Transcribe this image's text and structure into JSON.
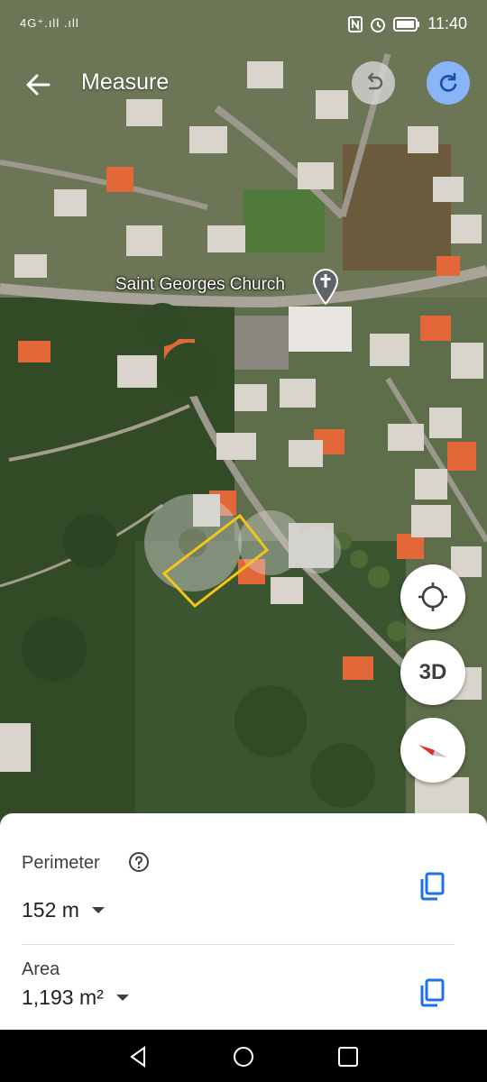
{
  "status_bar": {
    "network": "4G⁺.ıll .ıll",
    "time": "11:40"
  },
  "header": {
    "title": "Measure"
  },
  "map": {
    "poi_label": "Saint Georges Church"
  },
  "map_controls": {
    "three_d_label": "3D"
  },
  "measurements": {
    "perimeter_label": "Perimeter",
    "perimeter_value": "152 m",
    "area_label": "Area",
    "area_value": "1,193 m²"
  },
  "colors": {
    "accent": "#1a73e8",
    "polygon": "#f5c518",
    "redo_bg": "#8ab4f8"
  }
}
